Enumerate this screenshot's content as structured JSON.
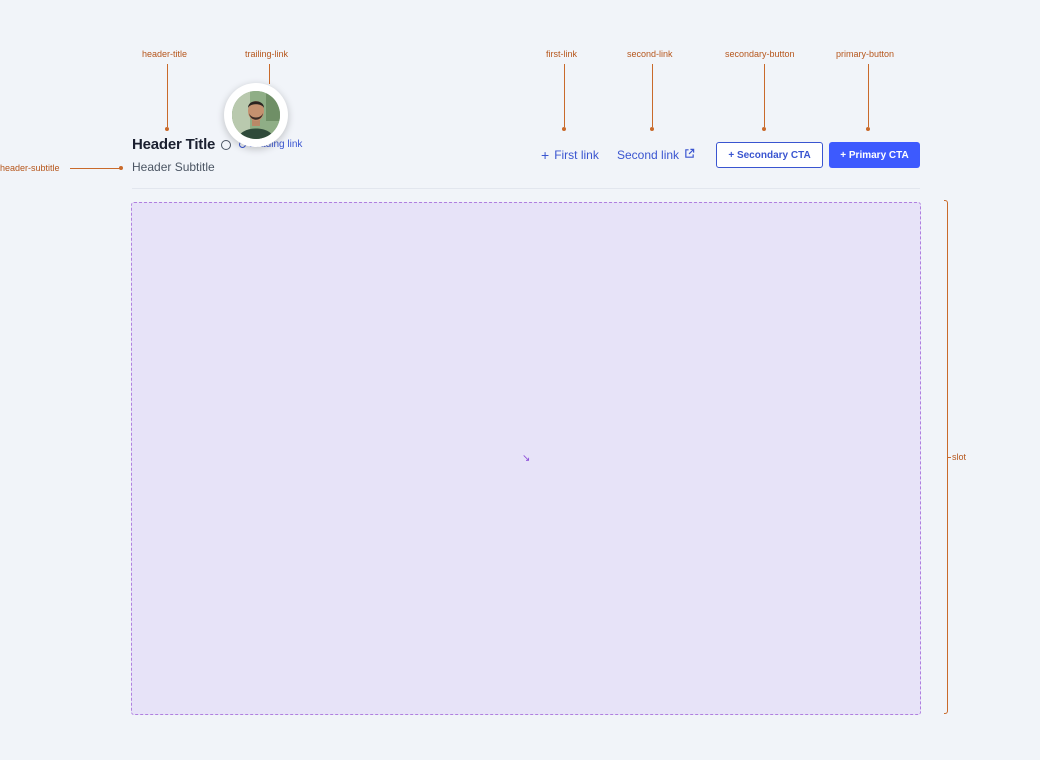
{
  "annotations": {
    "header_title": "header-title",
    "trailing_link": "trailing-link",
    "header_subtitle": "header-subtitle",
    "first_link": "first-link",
    "second_link": "second-link",
    "secondary_button": "secondary-button",
    "primary_button": "primary-button",
    "slot": "slot"
  },
  "header": {
    "title": "Header Title",
    "subtitle": "Header Subtitle",
    "leading_link": "Leading link"
  },
  "actions": {
    "first_link": "First link",
    "second_link": "Second link",
    "secondary_cta": "+ Secondary CTA",
    "primary_cta": "+ Primary CTA"
  },
  "slot": {
    "glyph": "↘"
  },
  "icons": {
    "info": "info-circle-icon",
    "link": "link-icon",
    "plus": "plus-icon",
    "external": "external-link-icon"
  },
  "colors": {
    "accent": "#3a55d0",
    "primary_button": "#3d5afe",
    "annotation": "#c96a2b",
    "slot_fill": "#e7e3f8",
    "slot_border": "#b07fe0",
    "background": "#f1f4f9"
  }
}
